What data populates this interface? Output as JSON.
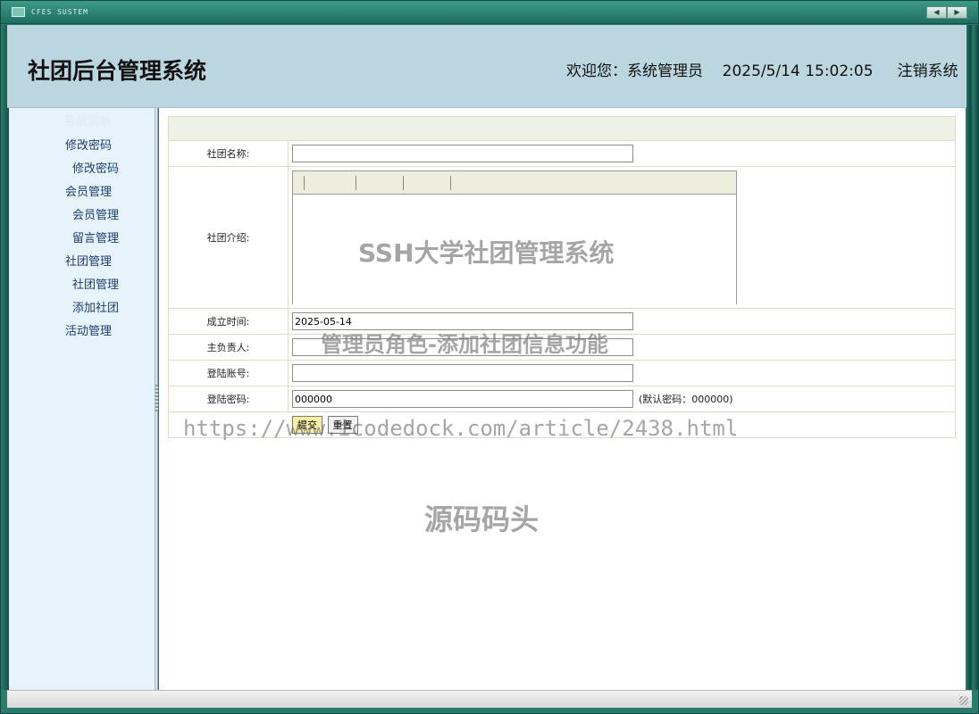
{
  "window": {
    "system_name": "CFES SUSTEM",
    "nav_prev": "◀",
    "nav_next": "▶"
  },
  "header": {
    "title": "社团后台管理系统",
    "welcome_label": "欢迎您：",
    "user_name": "系统管理员",
    "datetime": "2025/5/14 15:02:05",
    "logout": "注销系统"
  },
  "sidebar": {
    "menu_title": "导航菜单",
    "items": [
      {
        "label": "修改密码",
        "level": 1
      },
      {
        "label": "修改密码",
        "level": 2
      },
      {
        "label": "会员管理",
        "level": 1
      },
      {
        "label": "会员管理",
        "level": 2
      },
      {
        "label": "留言管理",
        "level": 2
      },
      {
        "label": "社团管理",
        "level": 1
      },
      {
        "label": "社团管理",
        "level": 2
      },
      {
        "label": "添加社团",
        "level": 2
      },
      {
        "label": "活动管理",
        "level": 1
      }
    ]
  },
  "form": {
    "club_name_label": "社团名称:",
    "club_name_value": "",
    "intro_label": "社团介绍:",
    "founded_label": "成立时间:",
    "founded_value": "2025-05-14",
    "leader_label": "主负责人:",
    "leader_value": "",
    "account_label": "登陆账号:",
    "account_value": "",
    "password_label": "登陆密码:",
    "password_value": "000000",
    "password_hint": "(默认密码：000000)",
    "submit_label": "提交",
    "reset_label": "重置"
  },
  "watermarks": {
    "line1": "SSH大学社团管理系统",
    "line2": "管理员角色-添加社团信息功能",
    "line3": "https://www.icodedock.com/article/2438.html",
    "line4": "源码码头"
  }
}
